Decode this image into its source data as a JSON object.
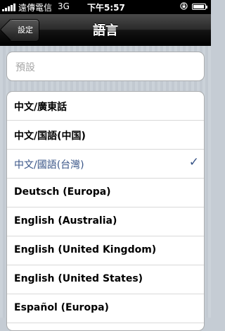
{
  "status_bar": {
    "carrier": "遠傳電信",
    "network": "3G",
    "time": "下午5:57",
    "battery_level": 0.85
  },
  "nav": {
    "back_label": "設定",
    "title": "語言"
  },
  "default_field": {
    "placeholder": "預設"
  },
  "languages": [
    {
      "label": "中文/廣東話",
      "selected": false
    },
    {
      "label": "中文/国語(中国)",
      "selected": false
    },
    {
      "label": "中文/國語(台灣)",
      "selected": true
    },
    {
      "label": "Deutsch (Europa)",
      "selected": false
    },
    {
      "label": "English (Australia)",
      "selected": false
    },
    {
      "label": "English (United Kingdom)",
      "selected": false
    },
    {
      "label": "English (United States)",
      "selected": false
    },
    {
      "label": "Español (Europa)",
      "selected": false
    }
  ],
  "check_glyph": "✓",
  "colors": {
    "selected_text": "#385487",
    "background": "#c5ccd4"
  }
}
